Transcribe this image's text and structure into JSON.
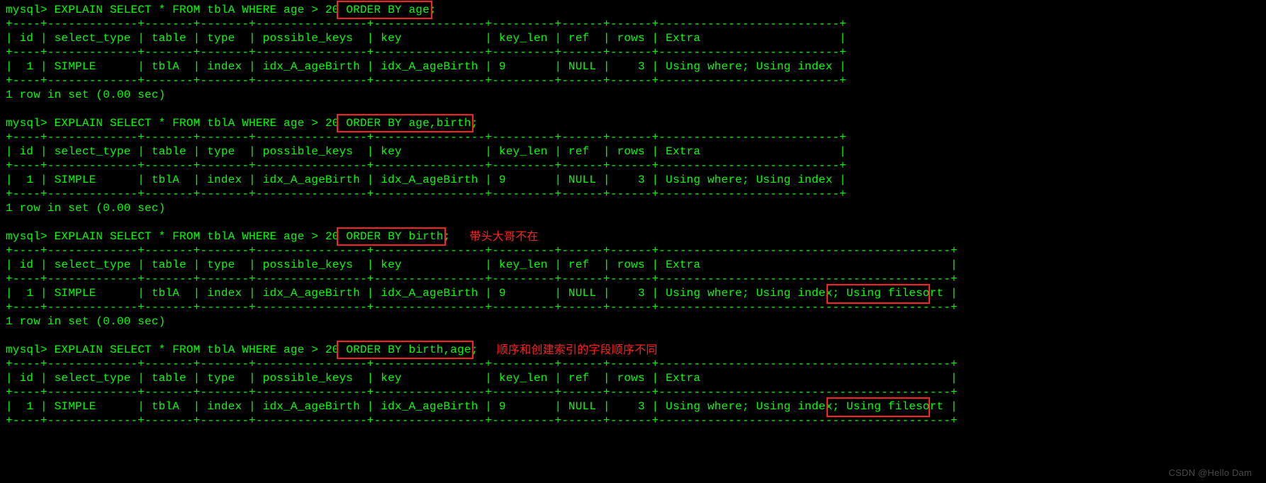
{
  "prompt": "mysql>",
  "queries": [
    {
      "sql_pre": "EXPLAIN SELECT * FROM tblA WHERE age > 20 ",
      "sql_box": "ORDER BY age;",
      "sql_post": "",
      "annotation": "",
      "extra": "Using where; Using index",
      "extra_filesort": "",
      "summary": "1 row in set (0.00 sec)"
    },
    {
      "sql_pre": "EXPLAIN SELECT * FROM tblA WHERE age > 20 ",
      "sql_box": "ORDER BY age,birth;",
      "sql_post": "",
      "annotation": "",
      "extra": "Using where; Using index",
      "extra_filesort": "",
      "summary": "1 row in set (0.00 sec)"
    },
    {
      "sql_pre": "EXPLAIN SELECT * FROM tblA WHERE age > 20 ",
      "sql_box": "ORDER BY birth;",
      "sql_post": "",
      "annotation": "带头大哥不在",
      "extra": "Using where; Using index; ",
      "extra_filesort": "Using filesort",
      "summary": "1 row in set (0.00 sec)"
    },
    {
      "sql_pre": "EXPLAIN SELECT * FROM tblA WHERE age > 20 ",
      "sql_box": "ORDER BY birth,age;",
      "sql_post": "",
      "annotation": "顺序和创建索引的字段顺序不同",
      "extra": "Using where; Using index; ",
      "extra_filesort": "Using filesort",
      "summary": ""
    }
  ],
  "header_columns": [
    "id",
    "select_type",
    "table",
    "type",
    "possible_keys",
    "key",
    "key_len",
    "ref",
    "rows",
    "Extra"
  ],
  "data_row": {
    "id": "1",
    "select_type": "SIMPLE",
    "table": "tblA",
    "type": "index",
    "possible_keys": "idx_A_ageBirth",
    "key": "idx_A_ageBirth",
    "key_len": "9",
    "ref": "NULL",
    "rows": "3"
  },
  "watermark": "CSDN @Hello Dam",
  "chart_data": {
    "type": "table",
    "title": "MySQL EXPLAIN output",
    "columns": [
      "id",
      "select_type",
      "table",
      "type",
      "possible_keys",
      "key",
      "key_len",
      "ref",
      "rows",
      "Extra"
    ],
    "rows": [
      [
        1,
        "SIMPLE",
        "tblA",
        "index",
        "idx_A_ageBirth",
        "idx_A_ageBirth",
        9,
        "NULL",
        3,
        "Using where; Using index"
      ],
      [
        1,
        "SIMPLE",
        "tblA",
        "index",
        "idx_A_ageBirth",
        "idx_A_ageBirth",
        9,
        "NULL",
        3,
        "Using where; Using index"
      ],
      [
        1,
        "SIMPLE",
        "tblA",
        "index",
        "idx_A_ageBirth",
        "idx_A_ageBirth",
        9,
        "NULL",
        3,
        "Using where; Using index; Using filesort"
      ],
      [
        1,
        "SIMPLE",
        "tblA",
        "index",
        "idx_A_ageBirth",
        "idx_A_ageBirth",
        9,
        "NULL",
        3,
        "Using where; Using index; Using filesort"
      ]
    ]
  }
}
